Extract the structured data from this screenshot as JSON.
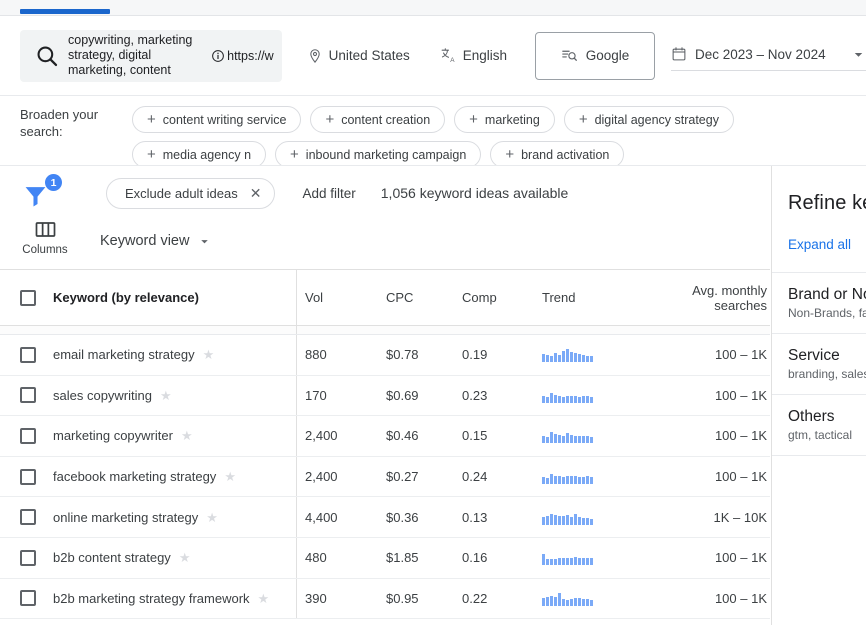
{
  "header": {
    "search": {
      "keywords_value": "copywriting, marketing strategy, digital marketing, content",
      "url_value": "https://w",
      "icon": "search-icon",
      "info_icon": "info-icon"
    },
    "location": {
      "label": "United States",
      "icon": "location-pin-icon"
    },
    "language": {
      "label": "English",
      "icon": "translate-icon"
    },
    "engine": {
      "label": "Google",
      "icon": "search-engine-icon"
    },
    "date_range": {
      "label": "Dec 2023 – Nov 2024",
      "icon": "calendar-icon",
      "caret": "chevron-down-icon"
    }
  },
  "broaden": {
    "label": "Broaden your search:",
    "chips": [
      "content writing service",
      "content creation",
      "marketing",
      "digital agency strategy",
      "media agency n",
      "inbound marketing campaign",
      "brand activation"
    ]
  },
  "toolbar": {
    "filter_badge_count": "1",
    "filter_icon": "filter-funnel-icon",
    "active_filter": "Exclude adult ideas",
    "remove_filter_icon": "close-icon",
    "add_filter": "Add filter",
    "ideas_count": "1,056 keyword ideas available",
    "columns_label": "Columns",
    "columns_icon": "columns-icon",
    "view_label": "Keyword view",
    "view_caret": "chevron-down-icon"
  },
  "table": {
    "columns": [
      "Keyword (by relevance)",
      "Vol",
      "CPC",
      "Comp",
      "Trend",
      "Avg. monthly searches"
    ],
    "select_all_icon": "checkbox-unchecked-icon",
    "rows": [
      {
        "keyword": "email marketing strategy",
        "vol": "880",
        "cpc": "$0.78",
        "comp": "0.19",
        "avg": "100 – 1K",
        "trend": [
          8,
          7,
          6,
          9,
          7,
          11,
          13,
          10,
          9,
          8,
          7,
          6,
          6
        ]
      },
      {
        "keyword": "sales copywriting",
        "vol": "170",
        "cpc": "$0.69",
        "comp": "0.23",
        "avg": "100 – 1K",
        "trend": [
          7,
          6,
          10,
          8,
          7,
          6,
          7,
          7,
          7,
          6,
          7,
          7,
          6
        ]
      },
      {
        "keyword": "marketing copywriter",
        "vol": "2,400",
        "cpc": "$0.46",
        "comp": "0.15",
        "avg": "100 – 1K",
        "trend": [
          7,
          6,
          11,
          9,
          8,
          7,
          10,
          8,
          7,
          7,
          7,
          7,
          6
        ]
      },
      {
        "keyword": "facebook marketing strategy",
        "vol": "2,400",
        "cpc": "$0.27",
        "comp": "0.24",
        "avg": "100 – 1K",
        "trend": [
          7,
          6,
          10,
          8,
          8,
          7,
          8,
          8,
          8,
          7,
          7,
          8,
          7
        ]
      },
      {
        "keyword": "online marketing strategy",
        "vol": "4,400",
        "cpc": "$0.36",
        "comp": "0.13",
        "avg": "1K – 10K",
        "trend": [
          8,
          9,
          11,
          10,
          9,
          9,
          10,
          8,
          11,
          8,
          7,
          7,
          6
        ]
      },
      {
        "keyword": "b2b content strategy",
        "vol": "480",
        "cpc": "$1.85",
        "comp": "0.16",
        "avg": "100 – 1K",
        "trend": [
          11,
          6,
          6,
          6,
          7,
          7,
          7,
          7,
          8,
          7,
          7,
          7,
          7
        ]
      },
      {
        "keyword": "b2b marketing strategy framework",
        "vol": "390",
        "cpc": "$0.95",
        "comp": "0.22",
        "avg": "100 – 1K",
        "trend": [
          8,
          9,
          10,
          9,
          13,
          7,
          6,
          7,
          8,
          8,
          7,
          7,
          6
        ]
      }
    ],
    "row_star_icon": "star-outline-icon",
    "row_checkbox_icon": "checkbox-unchecked-icon"
  },
  "refine_panel": {
    "title": "Refine keywords",
    "expand_all": "Expand all",
    "items": [
      {
        "title": "Brand or Non-Brand",
        "sub": "Non-Brands, fa"
      },
      {
        "title": "Service",
        "sub": "branding, sales"
      },
      {
        "title": "Others",
        "sub": "gtm, tactical"
      }
    ]
  },
  "colors": {
    "accent_blue": "#1a66cc",
    "link_blue": "#1a73e8",
    "badge_blue": "#4285f4",
    "sparkline_blue": "#7baaf7"
  }
}
